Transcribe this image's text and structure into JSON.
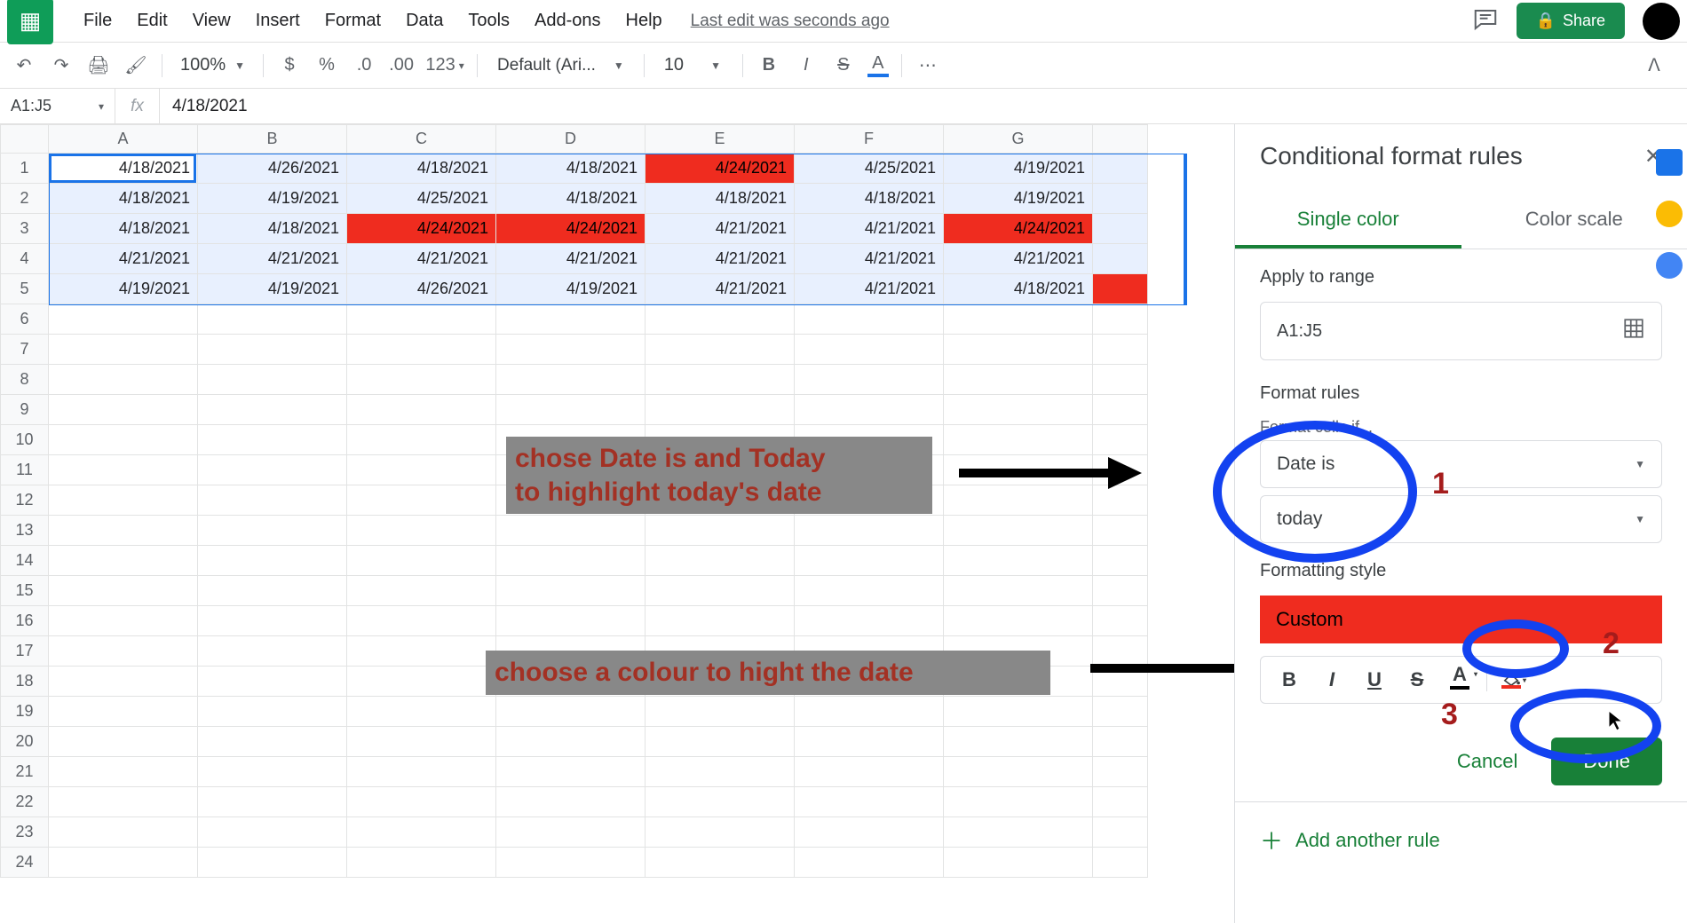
{
  "menu": {
    "items": [
      "File",
      "Edit",
      "View",
      "Insert",
      "Format",
      "Data",
      "Tools",
      "Add-ons",
      "Help"
    ],
    "last_edit": "Last edit was seconds ago",
    "share": "Share"
  },
  "toolbar": {
    "zoom": "100%",
    "fmt_123": "123",
    "font": "Default (Ari...",
    "size": "10"
  },
  "formula_bar": {
    "name_box": "A1:J5",
    "fx": "fx",
    "value": "4/18/2021"
  },
  "grid": {
    "cols": [
      "A",
      "B",
      "C",
      "D",
      "E",
      "F",
      "G"
    ],
    "rows": [
      [
        "4/18/2021",
        "4/26/2021",
        "4/18/2021",
        "4/18/2021",
        "4/24/2021",
        "4/25/2021",
        "4/19/2021"
      ],
      [
        "4/18/2021",
        "4/19/2021",
        "4/25/2021",
        "4/18/2021",
        "4/18/2021",
        "4/18/2021",
        "4/19/2021"
      ],
      [
        "4/18/2021",
        "4/18/2021",
        "4/24/2021",
        "4/24/2021",
        "4/21/2021",
        "4/21/2021",
        "4/24/2021"
      ],
      [
        "4/21/2021",
        "4/21/2021",
        "4/21/2021",
        "4/21/2021",
        "4/21/2021",
        "4/21/2021",
        "4/21/2021"
      ],
      [
        "4/19/2021",
        "4/19/2021",
        "4/26/2021",
        "4/19/2021",
        "4/21/2021",
        "4/21/2021",
        "4/18/2021"
      ]
    ],
    "highlights": [
      [
        0,
        4
      ],
      [
        2,
        2
      ],
      [
        2,
        3
      ],
      [
        2,
        6
      ]
    ],
    "extra_rows": 19
  },
  "sidebar": {
    "title": "Conditional format rules",
    "tabs": {
      "single": "Single color",
      "scale": "Color scale"
    },
    "apply_label": "Apply to range",
    "range": "A1:J5",
    "rules_label": "Format rules",
    "cells_if": "Format cells if...",
    "condition": "Date is",
    "condition_arg": "today",
    "style_label": "Formatting style",
    "style_name": "Custom",
    "cancel": "Cancel",
    "done": "Done",
    "add": "Add another rule"
  },
  "annotations": {
    "text1a": "chose Date is and Today",
    "text1b": "to highlight today's date",
    "text2": "choose a colour to hight the date",
    "n1": "1",
    "n2": "2",
    "n3": "3"
  }
}
